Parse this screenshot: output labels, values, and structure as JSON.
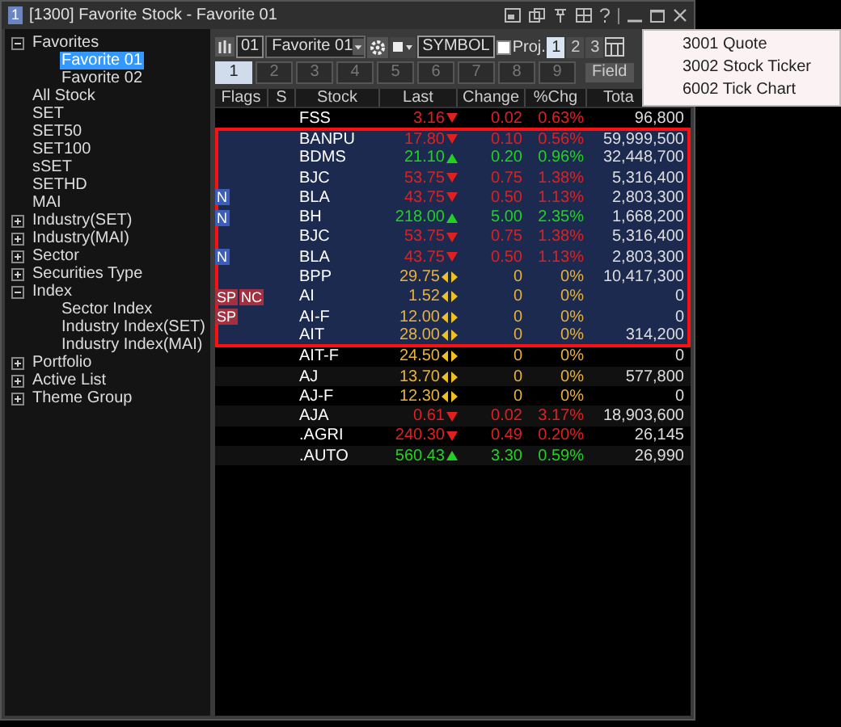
{
  "window": {
    "number": "1",
    "title": "[1300] Favorite Stock - Favorite 01"
  },
  "tree": [
    {
      "label": "Favorites",
      "expanded": true,
      "selected": false,
      "children": [
        {
          "label": "Favorite 01",
          "selected": true
        },
        {
          "label": "Favorite 02",
          "selected": false
        }
      ]
    },
    {
      "label": "All Stock",
      "selected": false
    },
    {
      "label": "SET",
      "selected": false
    },
    {
      "label": "SET50",
      "selected": false
    },
    {
      "label": "SET100",
      "selected": false
    },
    {
      "label": "sSET",
      "selected": false
    },
    {
      "label": "SETHD",
      "selected": false
    },
    {
      "label": "MAI",
      "selected": false
    },
    {
      "label": "Industry(SET)",
      "expanded": false,
      "selected": false
    },
    {
      "label": "Industry(MAI)",
      "expanded": false,
      "selected": false
    },
    {
      "label": "Sector",
      "expanded": false,
      "selected": false
    },
    {
      "label": "Securities Type",
      "expanded": false,
      "selected": false
    },
    {
      "label": "Index",
      "expanded": true,
      "selected": false,
      "children": [
        {
          "label": "Sector Index",
          "selected": false
        },
        {
          "label": "Industry Index(SET)",
          "selected": false
        },
        {
          "label": "Industry Index(MAI)",
          "selected": false
        }
      ]
    },
    {
      "label": "Portfolio",
      "expanded": false,
      "selected": false
    },
    {
      "label": "Active List",
      "expanded": false,
      "selected": false
    },
    {
      "label": "Theme Group",
      "expanded": false,
      "selected": false
    }
  ],
  "toolbar": {
    "list_number": "01",
    "list_select": "Favorite 01",
    "symbol_field": "SYMBOL",
    "proj_label": "Proj.",
    "proj_checked": false,
    "pages": [
      {
        "label": "1",
        "selected": true
      },
      {
        "label": "2",
        "selected": false
      },
      {
        "label": "3",
        "selected": false
      }
    ]
  },
  "tabs": [
    {
      "label": "1",
      "selected": true
    },
    {
      "label": "2",
      "selected": false
    },
    {
      "label": "3",
      "selected": false
    },
    {
      "label": "4",
      "selected": false
    },
    {
      "label": "5",
      "selected": false
    },
    {
      "label": "6",
      "selected": false
    },
    {
      "label": "7",
      "selected": false
    },
    {
      "label": "8",
      "selected": false
    },
    {
      "label": "9",
      "selected": false
    }
  ],
  "field_button": "Field",
  "table": {
    "columns": [
      "Flags",
      "S",
      "Stock",
      "Last",
      "Change",
      "%Chg",
      "Tota"
    ],
    "rows": [
      {
        "flags": [],
        "stock": "FSS",
        "last": "3.16",
        "kind": "down",
        "change": "0.02",
        "pct": "0.63%",
        "total": "96,800",
        "selected": false
      },
      {
        "flags": [],
        "stock": "BANPU",
        "last": "17.80",
        "kind": "down",
        "change": "0.10",
        "pct": "0.56%",
        "total": "59,999,500",
        "selected": true
      },
      {
        "flags": [],
        "stock": "BDMS",
        "last": "21.10",
        "kind": "up",
        "change": "0.20",
        "pct": "0.96%",
        "total": "32,448,700",
        "selected": true
      },
      {
        "flags": [],
        "stock": "BJC",
        "last": "53.75",
        "kind": "down",
        "change": "0.75",
        "pct": "1.38%",
        "total": "5,316,400",
        "selected": true
      },
      {
        "flags": [
          {
            "text": "N",
            "color": "#3b5fb8"
          }
        ],
        "stock": "BLA",
        "last": "43.75",
        "kind": "down",
        "change": "0.50",
        "pct": "1.13%",
        "total": "2,803,300",
        "selected": true
      },
      {
        "flags": [
          {
            "text": "N",
            "color": "#3b5fb8"
          }
        ],
        "stock": "BH",
        "last": "218.00",
        "kind": "up",
        "change": "5.00",
        "pct": "2.35%",
        "total": "1,668,200",
        "selected": true
      },
      {
        "flags": [],
        "stock": "BJC",
        "last": "53.75",
        "kind": "down",
        "change": "0.75",
        "pct": "1.38%",
        "total": "5,316,400",
        "selected": true
      },
      {
        "flags": [
          {
            "text": "N",
            "color": "#3b5fb8"
          }
        ],
        "stock": "BLA",
        "last": "43.75",
        "kind": "down",
        "change": "0.50",
        "pct": "1.13%",
        "total": "2,803,300",
        "selected": true
      },
      {
        "flags": [],
        "stock": "BPP",
        "last": "29.75",
        "kind": "flat",
        "change": "0",
        "pct": "0%",
        "total": "10,417,300",
        "selected": true
      },
      {
        "flags": [
          {
            "text": "SP",
            "color": "#a33040"
          },
          {
            "text": "NC",
            "color": "#a33040"
          }
        ],
        "stock": "AI",
        "last": "1.52",
        "kind": "flat",
        "change": "0",
        "pct": "0%",
        "total": "0",
        "selected": true
      },
      {
        "flags": [
          {
            "text": "SP",
            "color": "#a33040"
          }
        ],
        "stock": "AI-F",
        "last": "12.00",
        "kind": "flat",
        "change": "0",
        "pct": "0%",
        "total": "0",
        "selected": true
      },
      {
        "flags": [],
        "stock": "AIT",
        "last": "28.00",
        "kind": "flat",
        "change": "0",
        "pct": "0%",
        "total": "314,200",
        "selected": true
      },
      {
        "flags": [],
        "stock": "AIT-F",
        "last": "24.50",
        "kind": "flat",
        "change": "0",
        "pct": "0%",
        "total": "0",
        "selected": false
      },
      {
        "flags": [],
        "stock": "AJ",
        "last": "13.70",
        "kind": "flat",
        "change": "0",
        "pct": "0%",
        "total": "577,800",
        "selected": false
      },
      {
        "flags": [],
        "stock": "AJ-F",
        "last": "12.30",
        "kind": "flat",
        "change": "0",
        "pct": "0%",
        "total": "0",
        "selected": false
      },
      {
        "flags": [],
        "stock": "AJA",
        "last": "0.61",
        "kind": "down",
        "change": "0.02",
        "pct": "3.17%",
        "total": "18,903,600",
        "selected": false
      },
      {
        "flags": [],
        "stock": ".AGRI",
        "last": "240.30",
        "kind": "down",
        "change": "0.49",
        "pct": "0.20%",
        "total": "26,145",
        "selected": false
      },
      {
        "flags": [],
        "stock": ".AUTO",
        "last": "560.43",
        "kind": "up",
        "change": "3.30",
        "pct": "0.59%",
        "total": "26,990",
        "selected": false
      }
    ]
  },
  "context_menu": [
    "3001 Quote",
    "3002 Stock Ticker",
    "6002 Tick Chart"
  ]
}
